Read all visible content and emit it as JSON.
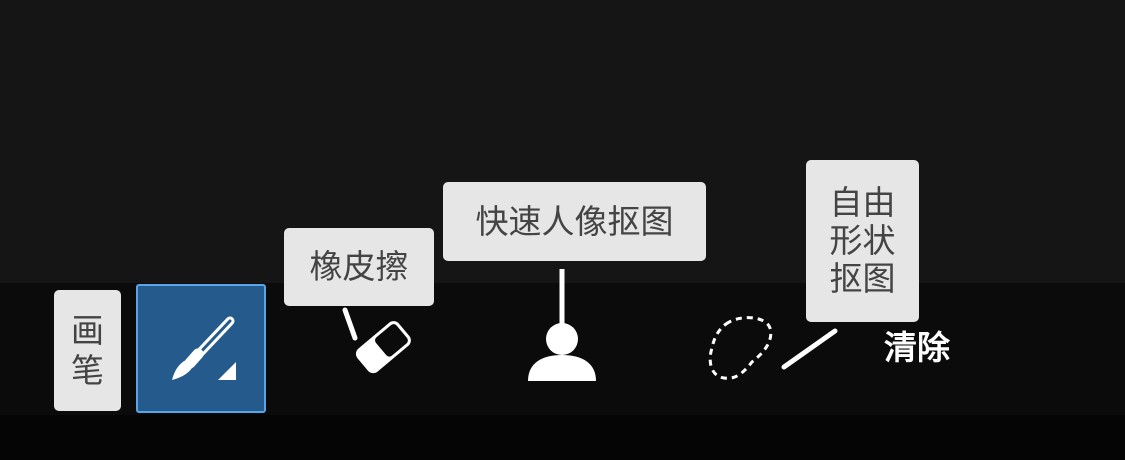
{
  "tooltips": {
    "brush": "画笔",
    "eraser": "橡皮擦",
    "quick_portrait_cutout": "快速人像抠图",
    "freeform_cutout": "自由形状抠图"
  },
  "tools": {
    "brush": {
      "icon": "paintbrush-icon",
      "selected": true
    },
    "eraser": {
      "icon": "eraser-icon"
    },
    "quick_portrait_cutout": {
      "icon": "person-icon"
    },
    "freeform_cutout": {
      "icon": "lasso-icon"
    },
    "clear": {
      "label": "清除"
    }
  },
  "colors": {
    "selected_bg": "#245a8c",
    "selected_border": "#5aa4e8",
    "tooltip_bg": "#e6e6e6",
    "toolbar_bg": "#0b0b0b",
    "canvas_bg": "#151515"
  }
}
